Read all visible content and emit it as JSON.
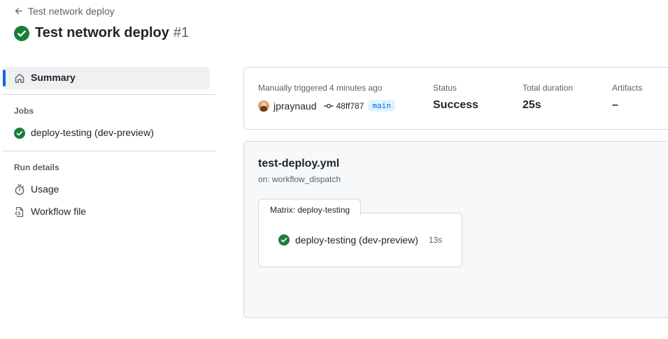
{
  "header": {
    "back_label": "Test network deploy",
    "title": "Test network deploy",
    "run_number": "#1"
  },
  "sidebar": {
    "summary_label": "Summary",
    "jobs_heading": "Jobs",
    "jobs": [
      {
        "label": "deploy-testing (dev-preview)",
        "status": "success"
      }
    ],
    "run_details_heading": "Run details",
    "details": [
      {
        "label": "Usage",
        "icon": "stopwatch-icon"
      },
      {
        "label": "Workflow file",
        "icon": "file-code-icon"
      }
    ]
  },
  "summary": {
    "trigger_text": "Manually triggered 4 minutes ago",
    "actor": "jpraynaud",
    "commit": "48ff787",
    "branch": "main",
    "status_label": "Status",
    "status_value": "Success",
    "duration_label": "Total duration",
    "duration_value": "25s",
    "artifacts_label": "Artifacts",
    "artifacts_value": "–"
  },
  "graph": {
    "workflow_file": "test-deploy.yml",
    "trigger": "on: workflow_dispatch",
    "matrix_label": "Matrix: deploy-testing",
    "job_label": "deploy-testing (dev-preview)",
    "job_duration": "13s"
  },
  "colors": {
    "success": "#1a7f37",
    "accent": "#0969da",
    "muted": "#59636e",
    "border": "#d1d9e0"
  }
}
